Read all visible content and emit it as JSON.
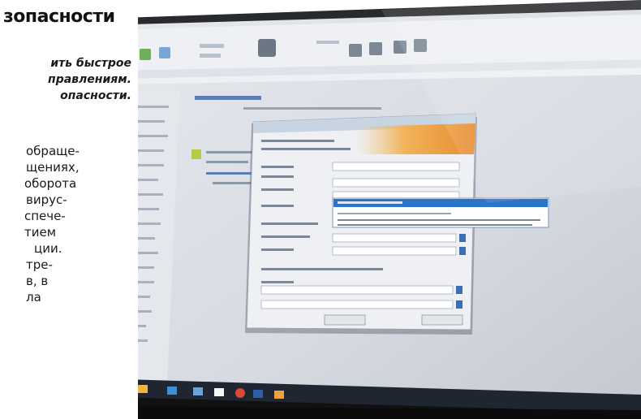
{
  "article": {
    "title": "зопасности",
    "lead": [
      "ить быстрое",
      "правлениям.",
      "опасности."
    ],
    "body": [
      "обраще-",
      "щениях,",
      "оборота",
      "вирус-",
      "спече-",
      "тием",
      "ции.",
      "тре-",
      "в, в",
      "ла"
    ]
  },
  "photo": {
    "subject": "monitor-with-dialog",
    "colors": {
      "screen": "#d9dde3",
      "dialog": "#eef0f3",
      "highlight": "#2a74c9",
      "frame": "#1b1b1c",
      "taskbar": "#1f2632"
    }
  }
}
